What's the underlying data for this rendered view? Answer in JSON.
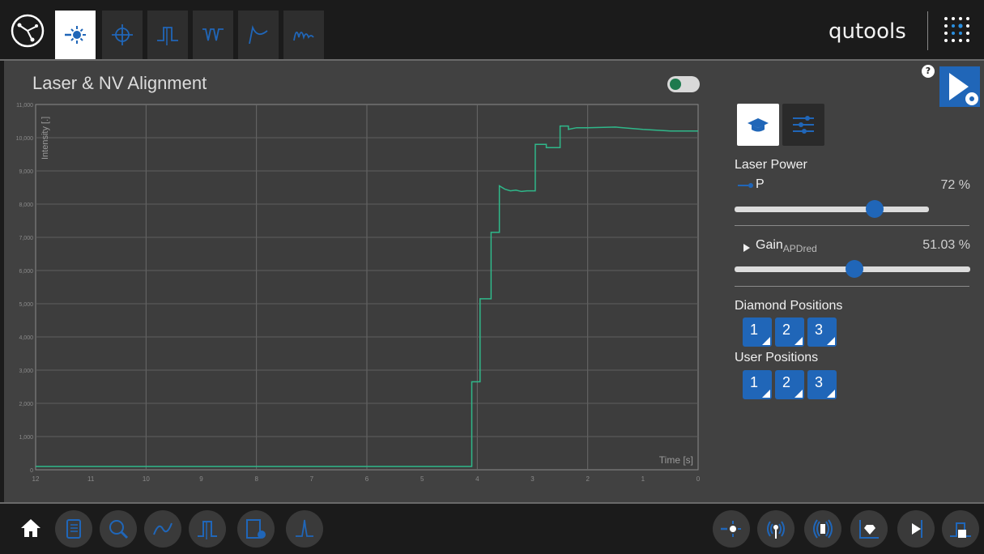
{
  "header": {
    "brand": "qutools",
    "tabs": [
      {
        "name": "alignment"
      },
      {
        "name": "odmr-scan"
      },
      {
        "name": "pulse"
      },
      {
        "name": "odmr"
      },
      {
        "name": "rabi"
      },
      {
        "name": "wave"
      }
    ]
  },
  "page": {
    "title": "Laser & NV Alignment"
  },
  "controls": {
    "help": "?",
    "laser_power_label": "Laser Power",
    "p_label": "P",
    "p_value": "72 %",
    "p_fraction": 0.72,
    "gain_label": "Gain",
    "gain_sub": "APDred",
    "gain_value": "51.03 %",
    "gain_fraction": 0.5103,
    "diamond_positions_label": "Diamond Positions",
    "user_positions_label": "User Positions",
    "diamond_buttons": [
      "1",
      "2",
      "3"
    ],
    "user_buttons": [
      "1",
      "2",
      "3"
    ]
  },
  "colors": {
    "accent": "#2066b8",
    "trace": "#2fb88a",
    "panel": "#414141"
  },
  "chart_data": {
    "type": "line",
    "title": "",
    "xlabel": "Time [s]",
    "ylabel": "Intensity [.]",
    "xlim": [
      12,
      0
    ],
    "ylim": [
      0,
      11000
    ],
    "x_ticks": [
      "12",
      "11",
      "10",
      "9",
      "8",
      "7",
      "6",
      "5",
      "4",
      "3",
      "2",
      "1",
      "0"
    ],
    "y_ticks": [
      "0",
      "1,000",
      "2,000",
      "3,000",
      "4,000",
      "5,000",
      "6,000",
      "7,000",
      "8,000",
      "9,000",
      "10,000",
      "11,000"
    ],
    "series": [
      {
        "x": [
          12,
          4.1,
          4.1,
          3.95,
          3.95,
          3.75,
          3.75,
          3.6,
          3.6,
          3.5,
          3.4,
          3.3,
          3.2,
          3.1,
          2.95,
          2.95,
          2.75,
          2.75,
          2.5,
          2.5,
          2.35,
          2.35,
          2.2,
          2.0,
          1.5,
          1.0,
          0.5,
          0.0
        ],
        "y": [
          100,
          100,
          2650,
          2650,
          5150,
          5150,
          7150,
          7150,
          8550,
          8450,
          8400,
          8420,
          8380,
          8400,
          8400,
          9800,
          9800,
          9700,
          9700,
          10350,
          10350,
          10250,
          10300,
          10300,
          10320,
          10250,
          10200,
          10200
        ]
      }
    ],
    "grid": true
  },
  "footer": {
    "left_buttons": [
      "home",
      "notebook",
      "search",
      "curve",
      "pulse",
      "settings-file",
      "spectrum"
    ],
    "right_buttons": [
      "alignment",
      "antenna",
      "magnet",
      "diamond-plot",
      "play",
      "pulse-seq"
    ]
  }
}
